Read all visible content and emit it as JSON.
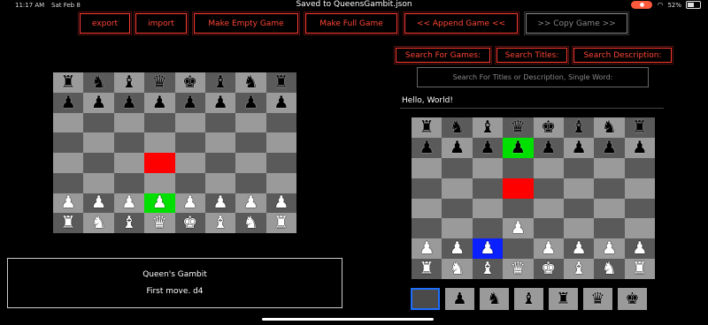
{
  "status": {
    "time": "11:17 AM",
    "date": "Sat Feb 8",
    "title": "Saved to QueensGambit.json",
    "battery": "52%"
  },
  "toolbar": {
    "export": "export",
    "import": "import",
    "empty": "Make Empty Game",
    "full": "Make Full Game",
    "append": "<< Append Game <<",
    "copy": ">> Copy Game >>"
  },
  "search": {
    "games": "Search For Games:",
    "titles": "Search Titles:",
    "description": "Search Description:",
    "placeholder": "Search For Titles or Description, Single Word:"
  },
  "hello": "Hello, World!",
  "game_notes": {
    "title": "Queen's Gambit",
    "move": "First move.  d4"
  },
  "highlight_colors": {
    "green": "#00e000",
    "red": "#ff0000",
    "blue": "#0a20ff"
  },
  "board_left": {
    "rows": [
      [
        "br",
        "bn",
        "bb",
        "bq",
        "bk",
        "bb",
        "bn",
        "br"
      ],
      [
        "bp",
        "bp",
        "bp",
        "bp",
        "bp",
        "bp",
        "bp",
        "bp"
      ],
      [
        "",
        "",
        "",
        "",
        "",
        "",
        "",
        ""
      ],
      [
        "",
        "",
        "",
        "",
        "",
        "",
        "",
        ""
      ],
      [
        "",
        "",
        "",
        "",
        "",
        "",
        "",
        ""
      ],
      [
        "",
        "",
        "",
        "",
        "",
        "",
        "",
        ""
      ],
      [
        "wp",
        "wp",
        "wp",
        "wp",
        "wp",
        "wp",
        "wp",
        "wp"
      ],
      [
        "wr",
        "wn",
        "wb",
        "wq",
        "wk",
        "wb",
        "wn",
        "wr"
      ]
    ],
    "highlights": [
      {
        "r": 4,
        "c": 3,
        "color": "red"
      },
      {
        "r": 6,
        "c": 3,
        "color": "green"
      }
    ]
  },
  "board_right": {
    "rows": [
      [
        "br",
        "bn",
        "bb",
        "bq",
        "bk",
        "bb",
        "bn",
        "br"
      ],
      [
        "bp",
        "bp",
        "bp",
        "bp",
        "bp",
        "bp",
        "bp",
        "bp"
      ],
      [
        "",
        "",
        "",
        "",
        "",
        "",
        "",
        ""
      ],
      [
        "",
        "",
        "",
        "",
        "",
        "",
        "",
        ""
      ],
      [
        "",
        "",
        "",
        "",
        "",
        "",
        "",
        ""
      ],
      [
        "",
        "",
        "",
        "wp",
        "",
        "",
        "",
        ""
      ],
      [
        "wp",
        "wp",
        "wp",
        "",
        "wp",
        "wp",
        "wp",
        "wp"
      ],
      [
        "wr",
        "wn",
        "wb",
        "wq",
        "wk",
        "wb",
        "wn",
        "wr"
      ]
    ],
    "highlights": [
      {
        "r": 1,
        "c": 3,
        "color": "green"
      },
      {
        "r": 3,
        "c": 3,
        "color": "red"
      },
      {
        "r": 6,
        "c": 2,
        "color": "blue"
      }
    ]
  },
  "piece_tray": [
    "",
    "bp",
    "bn",
    "bb",
    "br",
    "bq",
    "bk"
  ]
}
